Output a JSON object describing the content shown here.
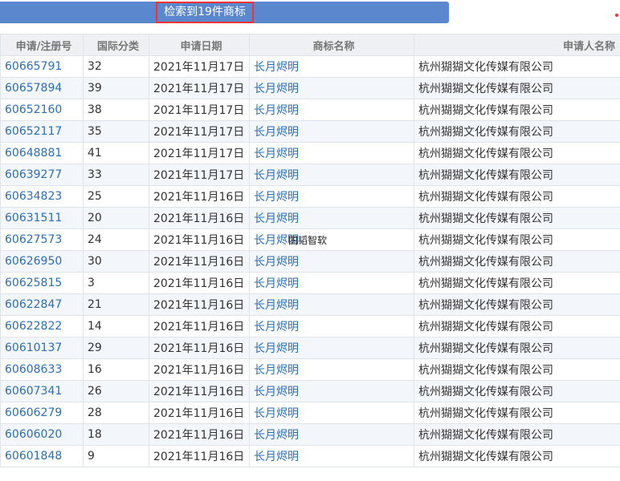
{
  "header": {
    "result_count_label": "检索到19件商标"
  },
  "columns": [
    "申请/注册号",
    "国际分类",
    "申请日期",
    "商标名称",
    "申请人名称"
  ],
  "rows": [
    {
      "reg": "60665791",
      "cls": "32",
      "date": "2021年11月17日",
      "name": "长月烬明",
      "applicant": "杭州猢猢文化传媒有限公司"
    },
    {
      "reg": "60657894",
      "cls": "39",
      "date": "2021年11月17日",
      "name": "长月烬明",
      "applicant": "杭州猢猢文化传媒有限公司"
    },
    {
      "reg": "60652160",
      "cls": "38",
      "date": "2021年11月17日",
      "name": "长月烬明",
      "applicant": "杭州猢猢文化传媒有限公司"
    },
    {
      "reg": "60652117",
      "cls": "35",
      "date": "2021年11月17日",
      "name": "长月烬明",
      "applicant": "杭州猢猢文化传媒有限公司"
    },
    {
      "reg": "60648881",
      "cls": "41",
      "date": "2021年11月17日",
      "name": "长月烬明",
      "applicant": "杭州猢猢文化传媒有限公司"
    },
    {
      "reg": "60639277",
      "cls": "33",
      "date": "2021年11月17日",
      "name": "长月烬明",
      "applicant": "杭州猢猢文化传媒有限公司"
    },
    {
      "reg": "60634823",
      "cls": "25",
      "date": "2021年11月16日",
      "name": "长月烬明",
      "applicant": "杭州猢猢文化传媒有限公司"
    },
    {
      "reg": "60631511",
      "cls": "20",
      "date": "2021年11月16日",
      "name": "长月烬明",
      "applicant": "杭州猢猢文化传媒有限公司"
    },
    {
      "reg": "60627573",
      "cls": "24",
      "date": "2021年11月16日",
      "name": "长月烬明",
      "applicant": "杭州猢猢文化传媒有限公司"
    },
    {
      "reg": "60626950",
      "cls": "30",
      "date": "2021年11月16日",
      "name": "长月烬明",
      "applicant": "杭州猢猢文化传媒有限公司"
    },
    {
      "reg": "60625815",
      "cls": "3",
      "date": "2021年11月16日",
      "name": "长月烬明",
      "applicant": "杭州猢猢文化传媒有限公司"
    },
    {
      "reg": "60622847",
      "cls": "21",
      "date": "2021年11月16日",
      "name": "长月烬明",
      "applicant": "杭州猢猢文化传媒有限公司"
    },
    {
      "reg": "60622822",
      "cls": "14",
      "date": "2021年11月16日",
      "name": "长月烬明",
      "applicant": "杭州猢猢文化传媒有限公司"
    },
    {
      "reg": "60610137",
      "cls": "29",
      "date": "2021年11月16日",
      "name": "长月烬明",
      "applicant": "杭州猢猢文化传媒有限公司"
    },
    {
      "reg": "60608633",
      "cls": "16",
      "date": "2021年11月16日",
      "name": "长月烬明",
      "applicant": "杭州猢猢文化传媒有限公司"
    },
    {
      "reg": "60607341",
      "cls": "26",
      "date": "2021年11月16日",
      "name": "长月烬明",
      "applicant": "杭州猢猢文化传媒有限公司"
    },
    {
      "reg": "60606279",
      "cls": "28",
      "date": "2021年11月16日",
      "name": "长月烬明",
      "applicant": "杭州猢猢文化传媒有限公司"
    },
    {
      "reg": "60606020",
      "cls": "18",
      "date": "2021年11月16日",
      "name": "长月烬明",
      "applicant": "杭州猢猢文化传媒有限公司"
    },
    {
      "reg": "60601848",
      "cls": "9",
      "date": "2021年11月16日",
      "name": "长月烬明",
      "applicant": "杭州猢猢文化传媒有限公司"
    }
  ],
  "watermark": "国韬智软",
  "colors": {
    "banner": "#5b87cf",
    "link": "#2a6fb8",
    "highlight_border": "#e33333"
  }
}
